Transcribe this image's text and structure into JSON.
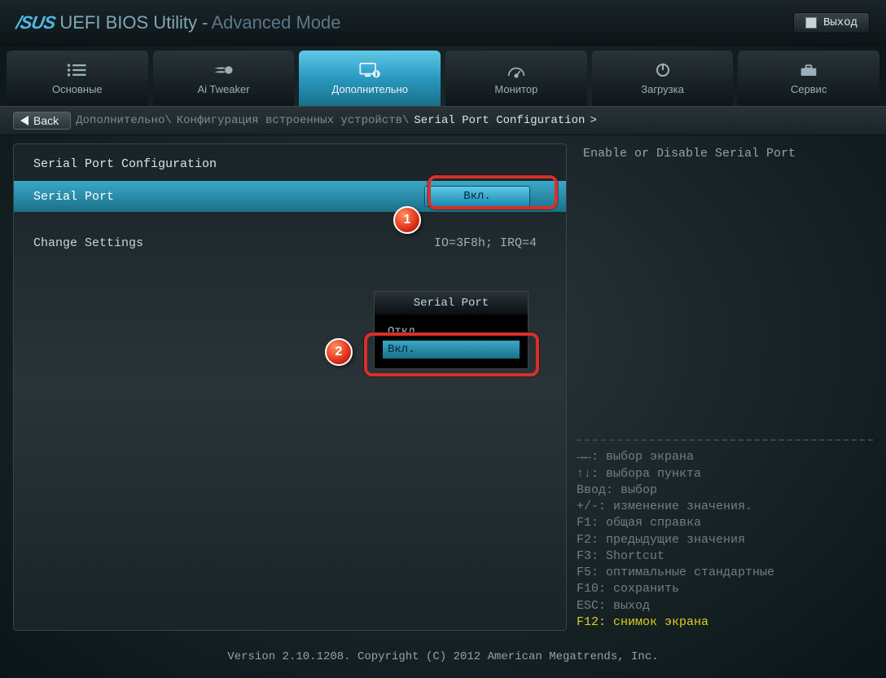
{
  "header": {
    "brand": "/SUS",
    "title": "UEFI BIOS Utility -",
    "subtitle": "Advanced Mode",
    "exit_label": "Выход"
  },
  "tabs": [
    {
      "label": "Основные"
    },
    {
      "label": "Ai Tweaker"
    },
    {
      "label": "Дополнительно"
    },
    {
      "label": "Монитор"
    },
    {
      "label": "Загрузка"
    },
    {
      "label": "Сервис"
    }
  ],
  "crumb": {
    "back_label": "Back",
    "path_1": "Дополнительно\\",
    "path_2": "Конфигурация встроенных устройств\\",
    "active": "Serial Port Configuration",
    "caret": ">"
  },
  "section": {
    "title": "Serial Port Configuration"
  },
  "settings": {
    "serial_port_label": "Serial Port",
    "serial_port_value": "Вкл.",
    "change_settings_label": "Change Settings",
    "change_settings_value": "IO=3F8h; IRQ=4"
  },
  "popup": {
    "title": "Serial Port",
    "options": [
      "Откл.",
      "Вкл."
    ],
    "selected_index": 1
  },
  "badges": {
    "one": "1",
    "two": "2"
  },
  "help": {
    "text": "Enable or Disable Serial Port"
  },
  "hints": [
    "→←: выбор экрана",
    "↑↓: выбора пункта",
    "Ввод: выбор",
    "+/-: изменение значения.",
    "F1: общая справка",
    "F2: предыдущие значения",
    "F3: Shortcut",
    "F5: оптимальные стандартные",
    "F10: сохранить",
    "ESC: выход"
  ],
  "hint_highlight": "F12: снимок экрана",
  "footer": {
    "text": "Version 2.10.1208. Copyright (C) 2012 American Megatrends, Inc."
  }
}
